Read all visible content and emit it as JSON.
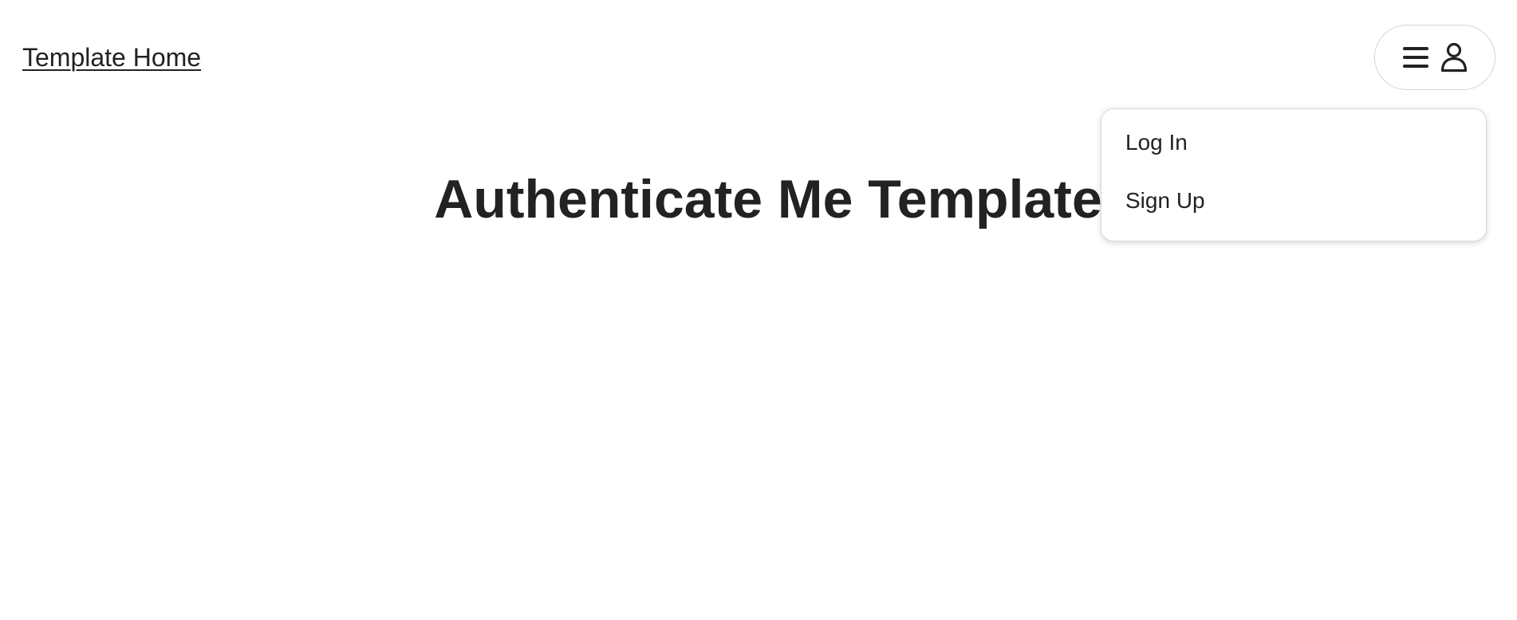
{
  "header": {
    "home_link": "Template Home"
  },
  "profile_button": {
    "icons": [
      "hamburger-icon",
      "user-icon"
    ]
  },
  "dropdown": {
    "items": [
      {
        "label": "Log In"
      },
      {
        "label": "Sign Up"
      }
    ]
  },
  "main": {
    "title": "Authenticate Me Template"
  }
}
